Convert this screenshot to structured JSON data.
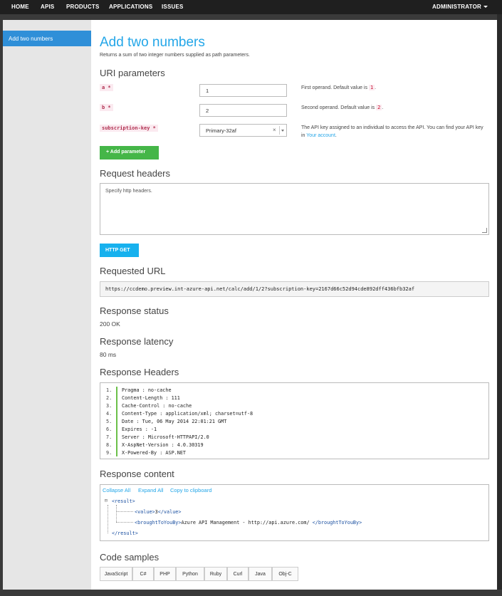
{
  "nav": {
    "items": [
      "HOME",
      "APIS",
      "PRODUCTS",
      "APPLICATIONS",
      "ISSUES"
    ],
    "admin": "ADMINISTRATOR"
  },
  "sidebar": {
    "active_item": "Add two numbers"
  },
  "operation": {
    "title": "Add two numbers",
    "description": "Returns a sum of two integer numbers supplied as path parameters."
  },
  "uri_parameters": {
    "heading": "URI parameters",
    "params": [
      {
        "name": "a *",
        "value": "1",
        "desc_prefix": "First operand. Default value is",
        "default": "1",
        "desc_suffix": "."
      },
      {
        "name": "b *",
        "value": "2",
        "desc_prefix": "Second operand. Default value is",
        "default": "2",
        "desc_suffix": "."
      }
    ],
    "subscription": {
      "name": "subscription-key *",
      "value": "Primary-32af",
      "clear": "×",
      "desc": "The API key assigned to an individual to access the API. You can find your API key in",
      "link": "Your account",
      "desc_end": "."
    },
    "add_button": "+ Add parameter"
  },
  "request_headers": {
    "heading": "Request headers",
    "placeholder": "Specify http headers."
  },
  "send_button": "HTTP GET",
  "requested_url": {
    "heading": "Requested URL",
    "value": "https://ccdemo.preview.int-azure-api.net/calc/add/1/2?subscription-key=2167d66c52d94cde892dff436bfb32af"
  },
  "response_status": {
    "heading": "Response status",
    "value": "200 OK"
  },
  "response_latency": {
    "heading": "Response latency",
    "value": "80 ms"
  },
  "response_headers": {
    "heading": "Response Headers",
    "lines": [
      {
        "n": "1.",
        "text": "Pragma : no-cache"
      },
      {
        "n": "2.",
        "text": "Content-Length : 111"
      },
      {
        "n": "3.",
        "text": "Cache-Control : no-cache"
      },
      {
        "n": "4.",
        "text": "Content-Type : application/xml; charset=utf-8"
      },
      {
        "n": "5.",
        "text": "Date : Tue, 06 May 2014 22:01:21 GMT"
      },
      {
        "n": "6.",
        "text": "Expires : -1"
      },
      {
        "n": "7.",
        "text": "Server : Microsoft-HTTPAPI/2.0"
      },
      {
        "n": "8.",
        "text": "X-AspNet-Version : 4.0.30319"
      },
      {
        "n": "9.",
        "text": "X-Powered-By : ASP.NET"
      }
    ]
  },
  "response_content": {
    "heading": "Response content",
    "tools": [
      "Collapse All",
      "Expand All",
      "Copy to clipboard"
    ],
    "toggle": "⊟",
    "result_open": "<result>",
    "value_open": "<value>",
    "value": "3",
    "value_close": "</value>",
    "brought_open": "<broughtToYouBy>",
    "brought": "Azure API Management - http://api.azure.com/ ",
    "brought_close": "</broughtToYouBy>",
    "result_close": "</result>"
  },
  "code_samples": {
    "heading": "Code samples",
    "tabs": [
      "JavaScript",
      "C#",
      "PHP",
      "Python",
      "Ruby",
      "Curl",
      "Java",
      "Obj-C"
    ]
  }
}
